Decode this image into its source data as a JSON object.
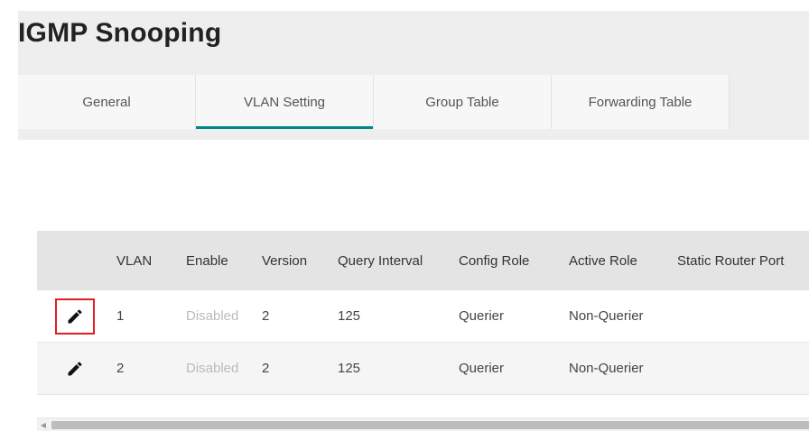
{
  "page": {
    "title": "IGMP Snooping"
  },
  "tabs": [
    {
      "label": "General"
    },
    {
      "label": "VLAN Setting",
      "active": true
    },
    {
      "label": "Group Table"
    },
    {
      "label": "Forwarding Table"
    }
  ],
  "table": {
    "columns": [
      "",
      "VLAN",
      "Enable",
      "Version",
      "Query Interval",
      "Config Role",
      "Active Role",
      "Static Router Port"
    ],
    "rows": [
      {
        "vlan": "1",
        "enable": "Disabled",
        "version": "2",
        "query_interval": "125",
        "config_role": "Querier",
        "active_role": "Non-Querier",
        "static_router_port": "",
        "edit_icon": "pencil-icon",
        "highlighted": true
      },
      {
        "vlan": "2",
        "enable": "Disabled",
        "version": "2",
        "query_interval": "125",
        "config_role": "Querier",
        "active_role": "Non-Querier",
        "static_router_port": "",
        "edit_icon": "pencil-icon",
        "highlighted": false
      }
    ]
  },
  "colors": {
    "accent": "#008787",
    "highlight": "#e01e25"
  }
}
